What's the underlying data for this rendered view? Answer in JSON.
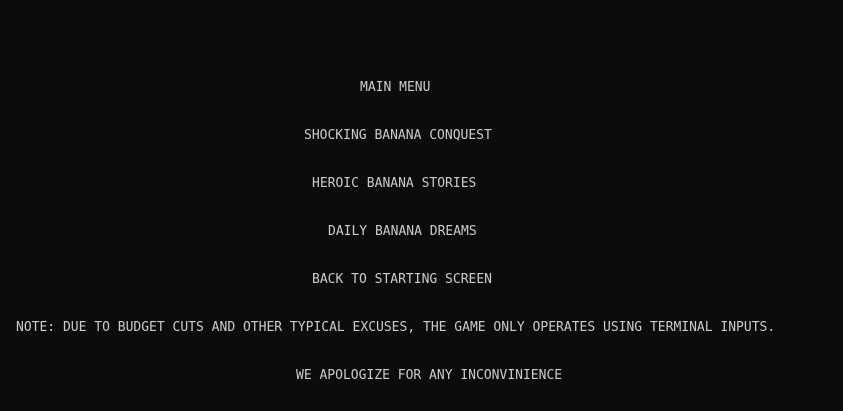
{
  "menu": {
    "title": "MAIN MENU",
    "options": [
      "SHOCKING BANANA CONQUEST",
      "HEROIC BANANA STORIES",
      "DAILY BANANA DREAMS",
      "BACK TO STARTING SCREEN"
    ]
  },
  "notice": {
    "note": "NOTE: DUE TO BUDGET CUTS AND OTHER TYPICAL EXCUSES, THE GAME ONLY OPERATES USING TERMINAL INPUTS.",
    "apology": "WE APOLOGIZE FOR ANY INCONVINIENCE"
  },
  "colors": {
    "background": "#0c0c0c",
    "text": "#cccccc"
  }
}
